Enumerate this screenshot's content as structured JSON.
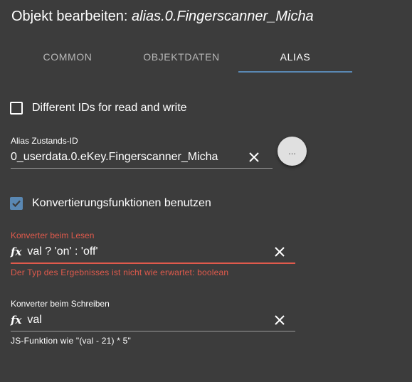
{
  "dialog": {
    "title_prefix": "Objekt bearbeiten:",
    "object_id": "alias.0.Fingerscanner_Micha"
  },
  "tabs": [
    {
      "label": "COMMON"
    },
    {
      "label": "OBJEKTDATEN"
    },
    {
      "label": "ALIAS"
    }
  ],
  "active_tab": "ALIAS",
  "different_ids": {
    "label": "Different IDs for read and write",
    "checked": false
  },
  "alias_state": {
    "label": "Alias Zustands-ID",
    "value": "0_userdata.0.eKey.Fingerscanner_Micha",
    "browse_label": "..."
  },
  "conversion": {
    "label": "Konvertierungsfunktionen benutzen",
    "checked": true
  },
  "read_converter": {
    "label": "Konverter beim Lesen",
    "value": "val ? 'on' : 'off'",
    "error": "Der Typ des Ergebnisses ist nicht wie erwartet: boolean"
  },
  "write_converter": {
    "label": "Konverter beim Schreiben",
    "value": "val",
    "helper": "JS-Funktion wie \"(val - 21) * 5\""
  },
  "colors": {
    "background": "#3c3c3c",
    "accent": "#5a88b3",
    "error": "#e05a4c"
  }
}
